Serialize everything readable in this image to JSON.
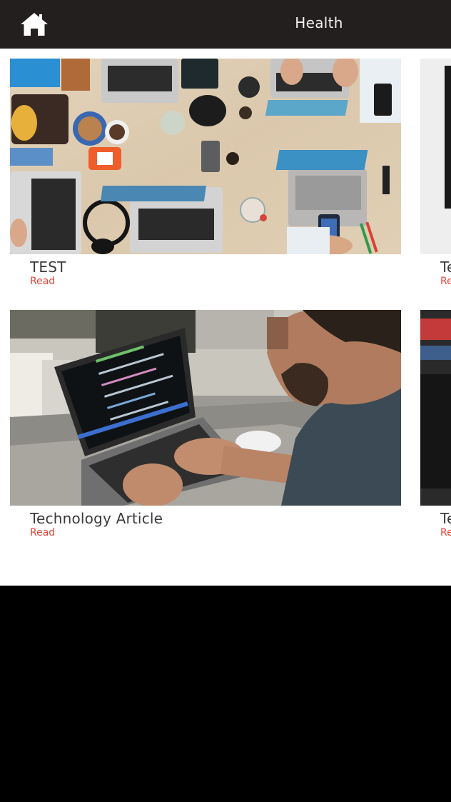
{
  "header": {
    "title": "Health",
    "home_icon": "home-icon"
  },
  "articles": [
    {
      "title": "TEST",
      "link_label": "Read"
    },
    {
      "title": "Technology Article",
      "link_label": "Read"
    }
  ],
  "peek_articles": [
    {
      "title": "Te",
      "link_label": "Re"
    },
    {
      "title": "Te",
      "link_label": "Re"
    }
  ],
  "colors": {
    "header_bg": "#221f1e",
    "link": "#e0443a",
    "title": "#3a3a3a",
    "background": "#ffffff"
  }
}
